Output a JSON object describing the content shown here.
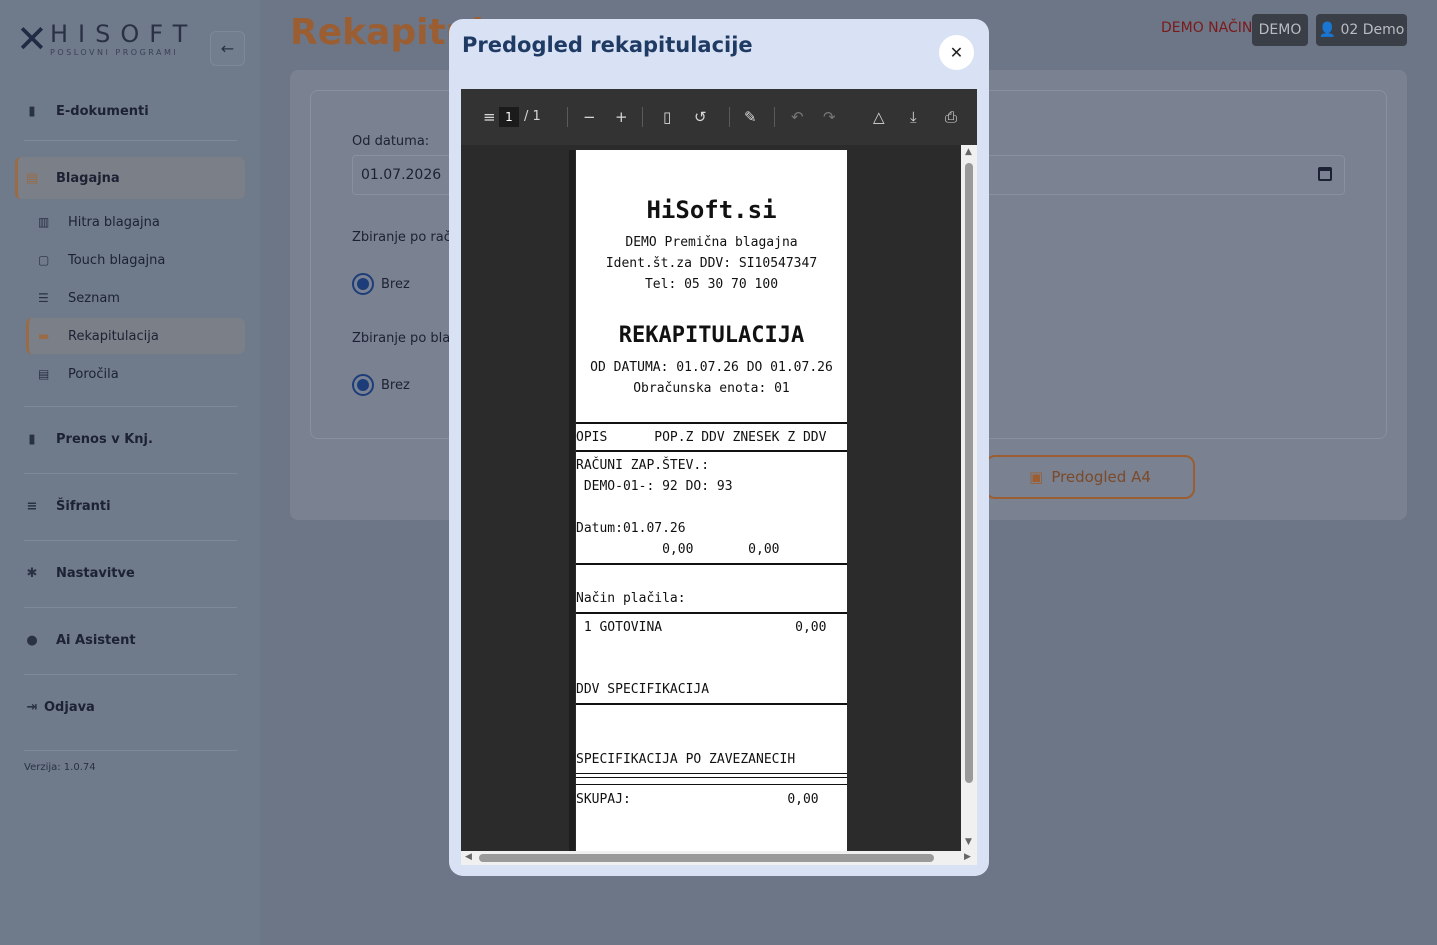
{
  "logo": {
    "main": "HISOFT",
    "sub": "POSLOVNI PROGRAMI"
  },
  "sidebar": {
    "items": [
      {
        "label": "E-dokumenti",
        "icon": "file-icon"
      },
      {
        "label": "Blagajna",
        "icon": "cash-register-icon"
      },
      {
        "label": "Prenos v Knj.",
        "icon": "book-icon"
      },
      {
        "label": "Šifranti",
        "icon": "database-icon"
      },
      {
        "label": "Nastavitve",
        "icon": "gear-icon"
      },
      {
        "label": "Ai Asistent",
        "icon": "brain-icon"
      },
      {
        "label": "Odjava",
        "icon": "logout-icon"
      }
    ],
    "sub_items": [
      {
        "label": "Hitra blagajna",
        "icon": "register-icon"
      },
      {
        "label": "Touch blagajna",
        "icon": "tablet-icon"
      },
      {
        "label": "Seznam",
        "icon": "list-icon"
      },
      {
        "label": "Rekapitulacija",
        "icon": "money-icon"
      },
      {
        "label": "Poročila",
        "icon": "report-icon"
      }
    ],
    "version": "Verzija: 1.0.74"
  },
  "header": {
    "title": "Rekapitula",
    "demo_mode": "DEMO NAČIN",
    "demo_button": "DEMO",
    "user_button": "02 Demo"
  },
  "form": {
    "od_datuma_label": "Od datuma:",
    "od_datuma_value": "01.07.2026",
    "zbiranje_racun_label": "Zbiranje po raču",
    "zbiranje_racun_option": "Brez",
    "zbiranje_blag_label": "Zbiranje po blag",
    "zbiranje_blag_option": "Brez",
    "predogled_a4": "Predogled A4"
  },
  "modal": {
    "title": "Predogled rekapitulacije",
    "toolbar": {
      "page_current": "1",
      "page_total": "/ 1"
    },
    "receipt": {
      "company": "HiSoft.si",
      "line1": "DEMO Premična blagajna",
      "line2": "Ident.št.za DDV: SI10547347",
      "line3": "Tel: 05 30 70 100",
      "heading": "REKAPITULACIJA",
      "period": "OD DATUMA: 01.07.26 DO 01.07.26",
      "unit": "Obračunska enota: 01",
      "columns": "OPIS      POP.Z DDV ZNESEK Z DDV",
      "racuni": "RAČUNI ZAP.ŠTEV.:",
      "racuni_range": " DEMO-01-: 92 DO: 93",
      "datum": "Datum:01.07.26",
      "amounts": "           0,00       0,00",
      "nacin": "Način plačila:",
      "gotovina": " 1 GOTOVINA                 0,00",
      "ddv_spec": "DDV SPECIFIKACIJA",
      "spec_zav": "SPECIFIKACIJA PO ZAVEZANECIH",
      "skupaj": "SKUPAJ:                    0,00"
    }
  }
}
